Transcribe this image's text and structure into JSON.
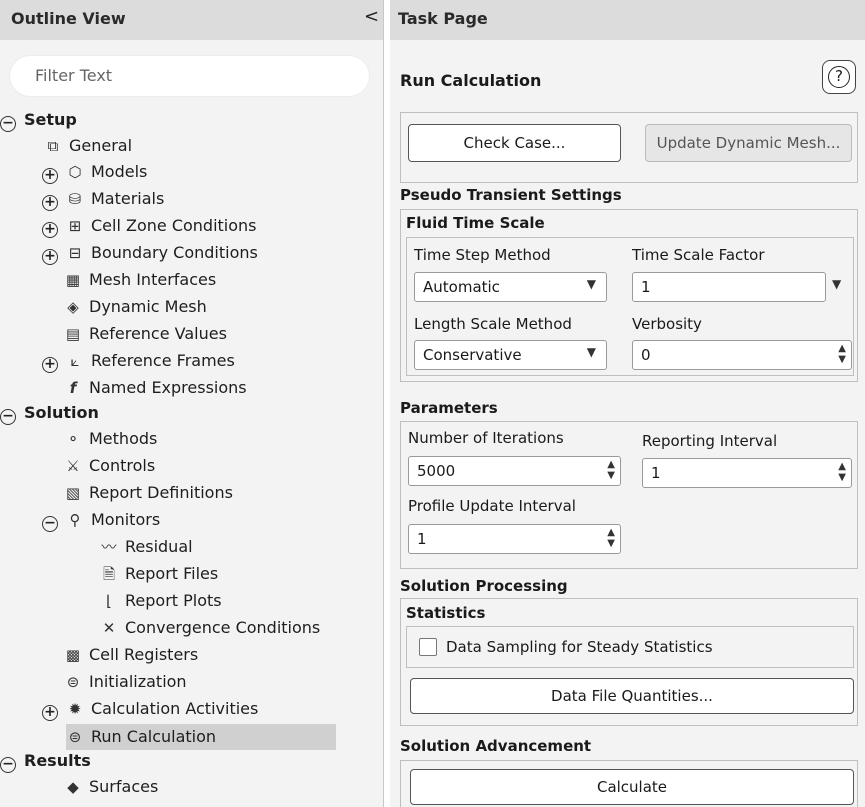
{
  "outline": {
    "title": "Outline View",
    "collapse_glyph": "<",
    "filter_placeholder": "Filter Text",
    "tree": {
      "setup": "Setup",
      "general": "General",
      "models": "Models",
      "materials": "Materials",
      "cell_zone_conditions": "Cell Zone Conditions",
      "boundary_conditions": "Boundary Conditions",
      "mesh_interfaces": "Mesh Interfaces",
      "dynamic_mesh": "Dynamic Mesh",
      "reference_values": "Reference Values",
      "reference_frames": "Reference Frames",
      "named_expressions": "Named Expressions",
      "solution": "Solution",
      "methods": "Methods",
      "controls": "Controls",
      "report_definitions": "Report Definitions",
      "monitors": "Monitors",
      "residual": "Residual",
      "report_files": "Report Files",
      "report_plots": "Report Plots",
      "convergence_conditions": "Convergence Conditions",
      "cell_registers": "Cell Registers",
      "initialization": "Initialization",
      "calculation_activities": "Calculation Activities",
      "run_calculation": "Run Calculation",
      "results": "Results",
      "surfaces": "Surfaces"
    }
  },
  "task": {
    "header": "Task Page",
    "title": "Run Calculation",
    "help_glyph": "?",
    "check_case": "Check Case...",
    "update_dynamic_mesh": "Update Dynamic Mesh...",
    "pseudo_transient_settings": "Pseudo Transient Settings",
    "fluid_time_scale": "Fluid Time Scale",
    "time_step_method_label": "Time Step Method",
    "time_step_method_value": "Automatic",
    "time_scale_factor_label": "Time Scale Factor",
    "time_scale_factor_value": "1",
    "length_scale_method_label": "Length Scale Method",
    "length_scale_method_value": "Conservative",
    "verbosity_label": "Verbosity",
    "verbosity_value": "0",
    "parameters": "Parameters",
    "num_iterations_label": "Number of Iterations",
    "num_iterations_value": "5000",
    "reporting_interval_label": "Reporting Interval",
    "reporting_interval_value": "1",
    "profile_update_interval_label": "Profile Update Interval",
    "profile_update_interval_value": "1",
    "solution_processing": "Solution Processing",
    "statistics": "Statistics",
    "data_sampling_label": "Data Sampling for Steady Statistics",
    "data_sampling_checked": false,
    "data_file_quantities": "Data File Quantities...",
    "solution_advancement": "Solution Advancement",
    "calculate": "Calculate"
  }
}
